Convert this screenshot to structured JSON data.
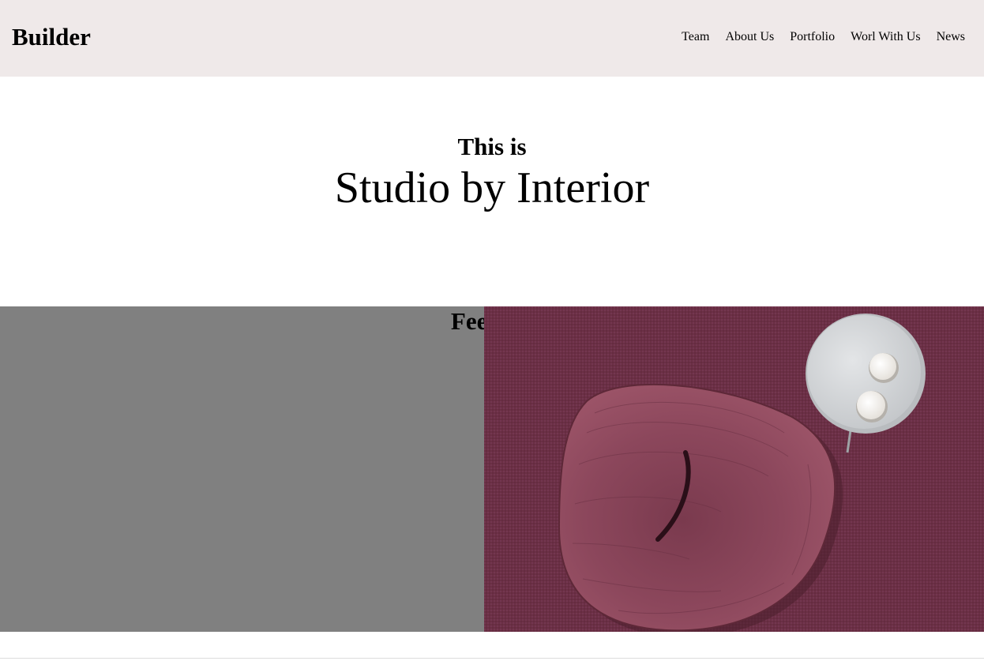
{
  "header": {
    "logo": "Builder",
    "nav": [
      "Team",
      "About Us",
      "Portfolio",
      "Worl With Us",
      "News"
    ]
  },
  "hero": {
    "intro": "This is",
    "title": "Studio by Interior"
  },
  "feature": {
    "heading": "Feel the"
  },
  "colors": {
    "header_bg": "#efe9e9",
    "feature_bg": "#808080",
    "photo_carpet": "#6e3347",
    "photo_chair": "#8a4559",
    "photo_table": "#d9dcdf"
  }
}
